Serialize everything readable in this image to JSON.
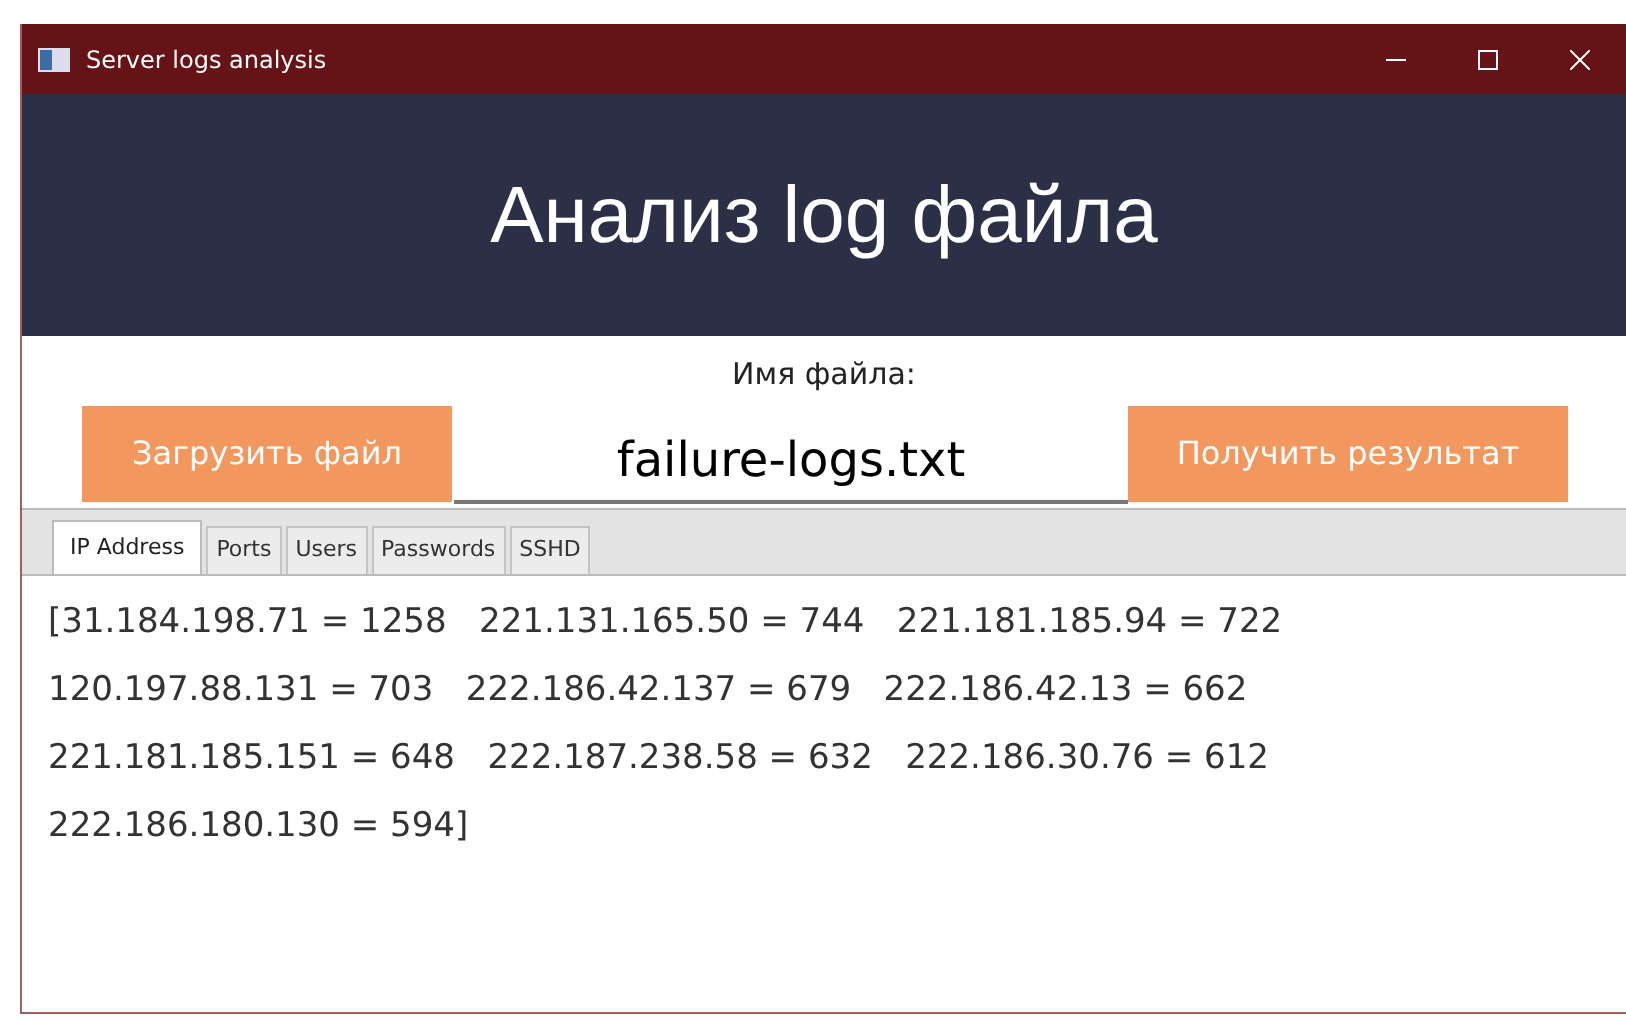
{
  "window": {
    "title": "Server logs analysis"
  },
  "header": {
    "title": "Анализ log файла"
  },
  "file": {
    "label": "Имя файла:",
    "value": "failure-logs.txt"
  },
  "buttons": [
    {
      "label": "Загрузить файл"
    },
    {
      "label": "Получить результат"
    }
  ],
  "tabs": [
    {
      "label": "IP Address",
      "selected": true
    },
    {
      "label": "Ports",
      "selected": false
    },
    {
      "label": "Users",
      "selected": false
    },
    {
      "label": "Passwords",
      "selected": false
    },
    {
      "label": "SSHD",
      "selected": false
    }
  ],
  "result": {
    "lines": [
      "[31.184.198.71 = 1258   221.131.165.50 = 744   221.181.185.94 = 722",
      "120.197.88.131 = 703   222.186.42.137 = 679   222.186.42.13 = 662",
      "221.181.185.151 = 648   222.187.238.58 = 632   222.186.30.76 = 612",
      "222.186.180.130 = 594]"
    ]
  }
}
